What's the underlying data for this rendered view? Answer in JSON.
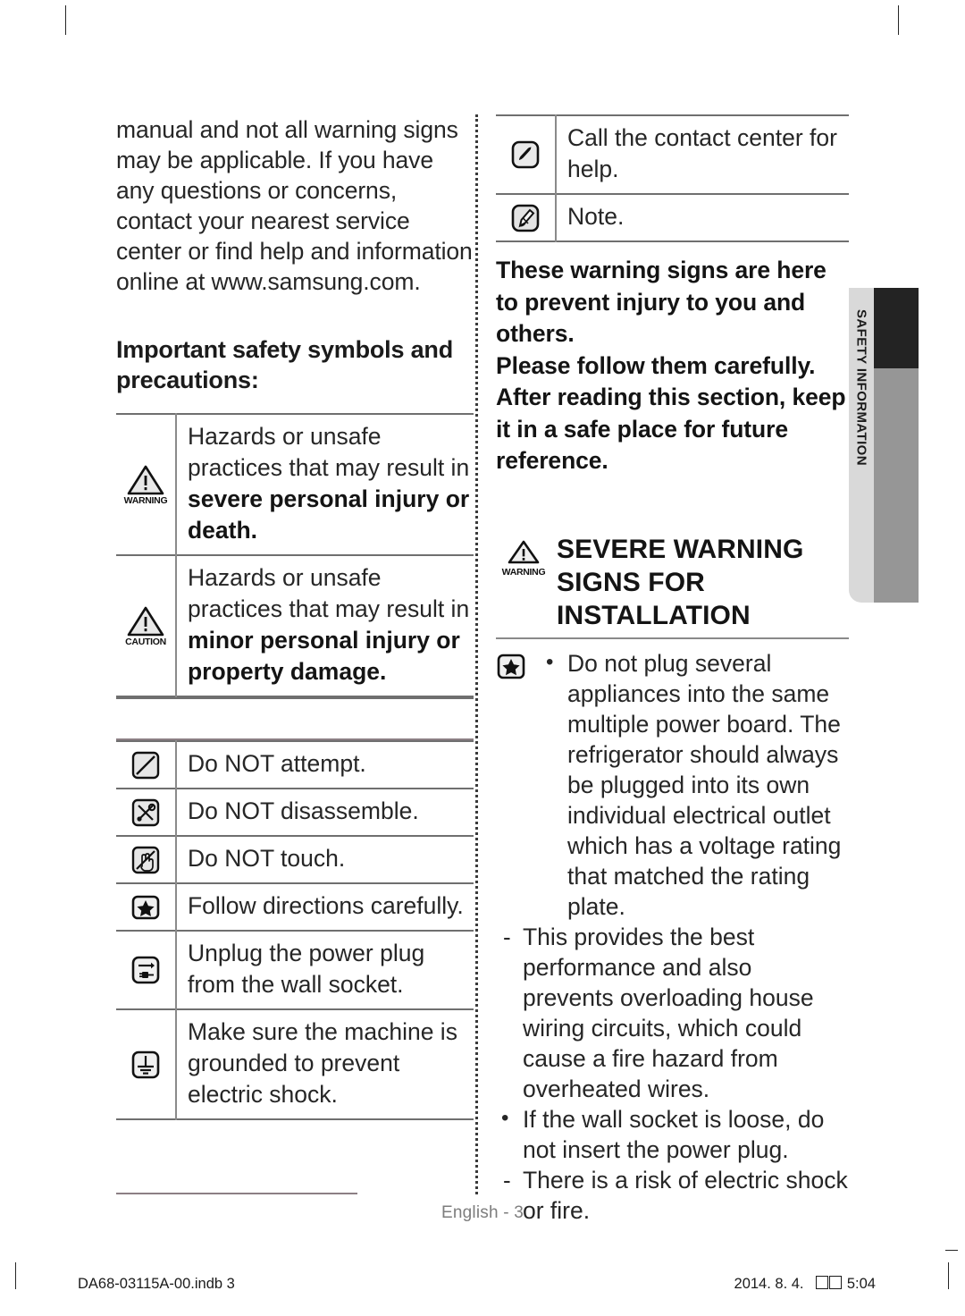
{
  "document": {
    "page_number_label": "English - 3",
    "imprint_left": "DA68-03115A-00.indb   3",
    "imprint_right_date": "2014. 8. 4.",
    "imprint_right_time": "5:04"
  },
  "side_tab": {
    "label": "SAFETY INFORMATION",
    "bg_color": "#d9d9d9",
    "bar_color": "#969696",
    "active_color": "#232323"
  },
  "left_column": {
    "intro_paragraph": "manual and not all warning signs may be applicable. If you have any questions or concerns, contact your nearest service center or find help and information online at www.samsung.com.",
    "section_heading": "Important safety symbols and precautions:",
    "severity_rows": [
      {
        "icon": "warning-triangle-icon",
        "icon_label": "WARNING",
        "text_plain": "Hazards or unsafe practices that may result in ",
        "text_bold": "severe personal injury or death."
      },
      {
        "icon": "caution-triangle-icon",
        "icon_label": "CAUTION",
        "text_plain": "Hazards or unsafe practices that may result in ",
        "text_bold": "minor personal injury or property damage."
      }
    ],
    "symbol_rows": [
      {
        "icon": "do-not-attempt-icon",
        "text": "Do NOT attempt."
      },
      {
        "icon": "do-not-disassemble-icon",
        "text": "Do NOT disassemble."
      },
      {
        "icon": "do-not-touch-icon",
        "text": "Do NOT touch."
      },
      {
        "icon": "star-follow-icon",
        "text": "Follow directions carefully."
      },
      {
        "icon": "unplug-icon",
        "text": "Unplug the power plug from the wall socket."
      },
      {
        "icon": "ground-icon",
        "text": "Make sure the machine is grounded to prevent electric shock."
      }
    ]
  },
  "right_column": {
    "symbol_rows": [
      {
        "icon": "phone-icon",
        "text": "Call the contact center for help."
      },
      {
        "icon": "note-pen-icon",
        "text": "Note."
      }
    ],
    "notice_paragraph": "These warning signs are here to prevent injury to you and others.\nPlease follow them carefully. After reading this section, keep it in a safe place for future reference.",
    "severe_heading": {
      "icon": "warning-triangle-icon",
      "icon_label": "WARNING",
      "title": "SEVERE WARNING SIGNS FOR INSTALLATION"
    },
    "bullets": [
      {
        "icon": "star-follow-icon",
        "marker": "dot",
        "text": "Do not plug several appliances into the same multiple power board. The refrigerator should always be plugged into its own individual electrical outlet which has a voltage rating that matched the rating plate."
      },
      {
        "marker": "dash",
        "text": "This provides the best performance and also prevents overloading house wiring circuits, which could cause a fire hazard from overheated wires."
      },
      {
        "marker": "dot",
        "text": "If the wall socket is loose, do not insert the power plug."
      },
      {
        "marker": "dash",
        "text": "There is a risk of electric shock or fire."
      }
    ]
  }
}
